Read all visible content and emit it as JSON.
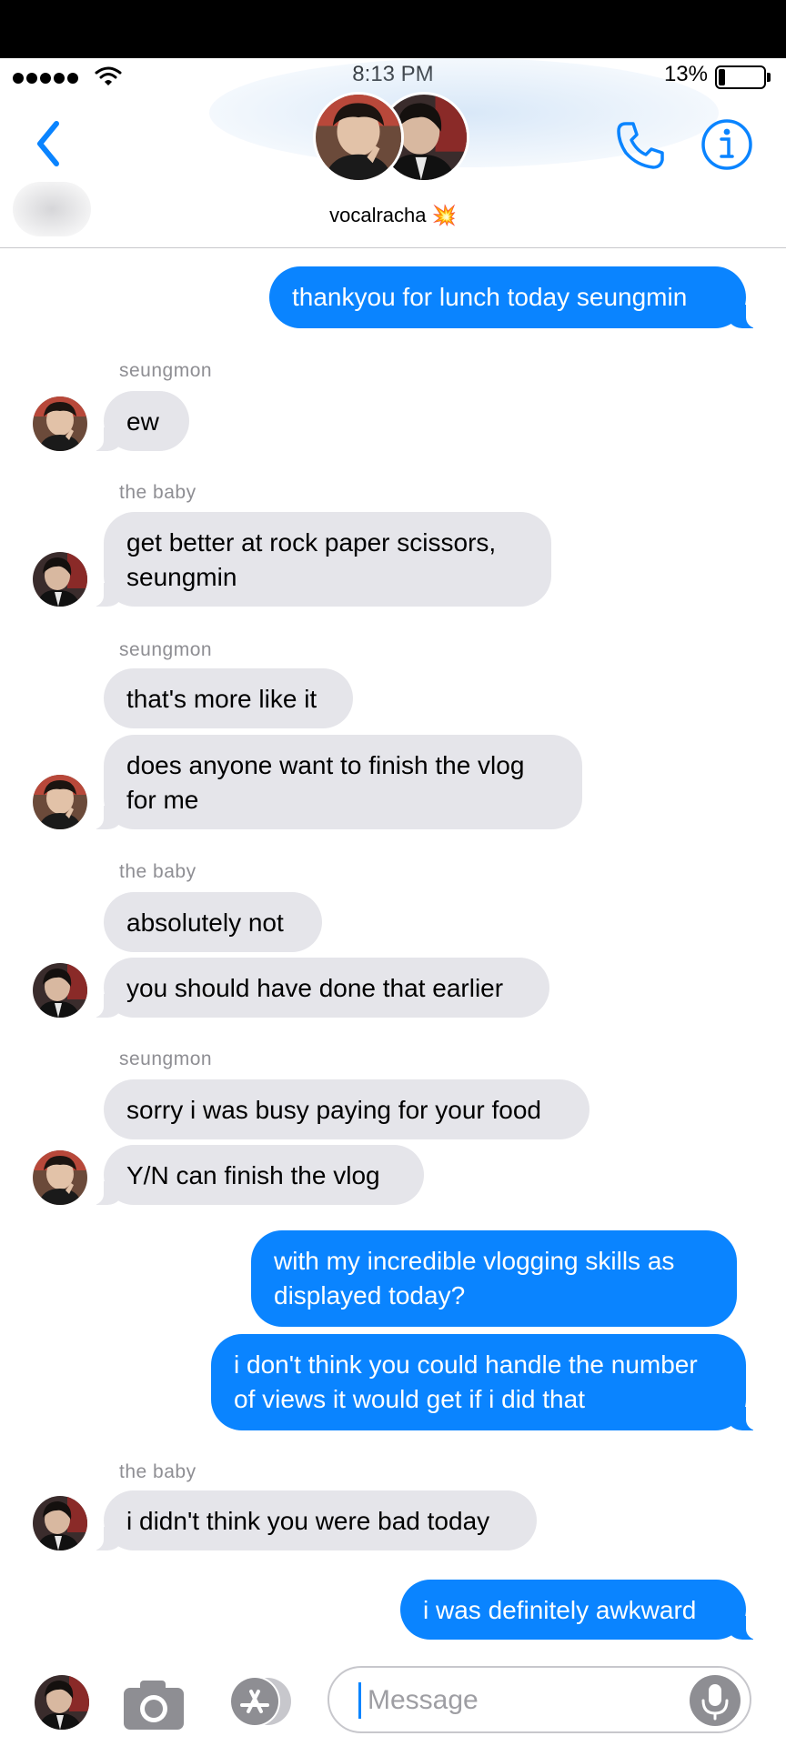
{
  "status": {
    "time": "8:13 PM",
    "battery": "13%"
  },
  "header": {
    "name": "vocalracha",
    "emoji": "💥"
  },
  "messages": [
    {
      "dir": "out",
      "text": "thankyou for lunch today seungmin"
    },
    {
      "dir": "in",
      "sender": "seungmon",
      "text": "ew"
    },
    {
      "dir": "in",
      "sender": "the baby",
      "text": "get better at rock paper scissors, seungmin"
    },
    {
      "dir": "in",
      "sender": "seungmon",
      "text": "that's more like it"
    },
    {
      "dir": "in",
      "text": "does anyone want to finish the vlog for me"
    },
    {
      "dir": "in",
      "sender": "the baby",
      "text": "absolutely not"
    },
    {
      "dir": "in",
      "text": "you should have done that earlier"
    },
    {
      "dir": "in",
      "sender": "seungmon",
      "text": "sorry i was busy paying for your food"
    },
    {
      "dir": "in",
      "text": "Y/N can finish the vlog"
    },
    {
      "dir": "out",
      "text": "with my incredible vlogging skills as displayed today?"
    },
    {
      "dir": "out",
      "text": "i don't think you could handle the number of views it would get if i did that"
    },
    {
      "dir": "in",
      "sender": "the baby",
      "text": "i didn't think you were bad today"
    },
    {
      "dir": "out",
      "text": "i was definitely awkward"
    }
  ],
  "input": {
    "placeholder": "Message"
  },
  "colors": {
    "accent": "#0a84ff",
    "incoming_bubble": "#e5e5ea",
    "sender_label": "#8e8e93"
  },
  "icons": [
    "back-chevron-icon",
    "phone-icon",
    "info-icon",
    "camera-icon",
    "app-store-icon",
    "microphone-icon"
  ]
}
